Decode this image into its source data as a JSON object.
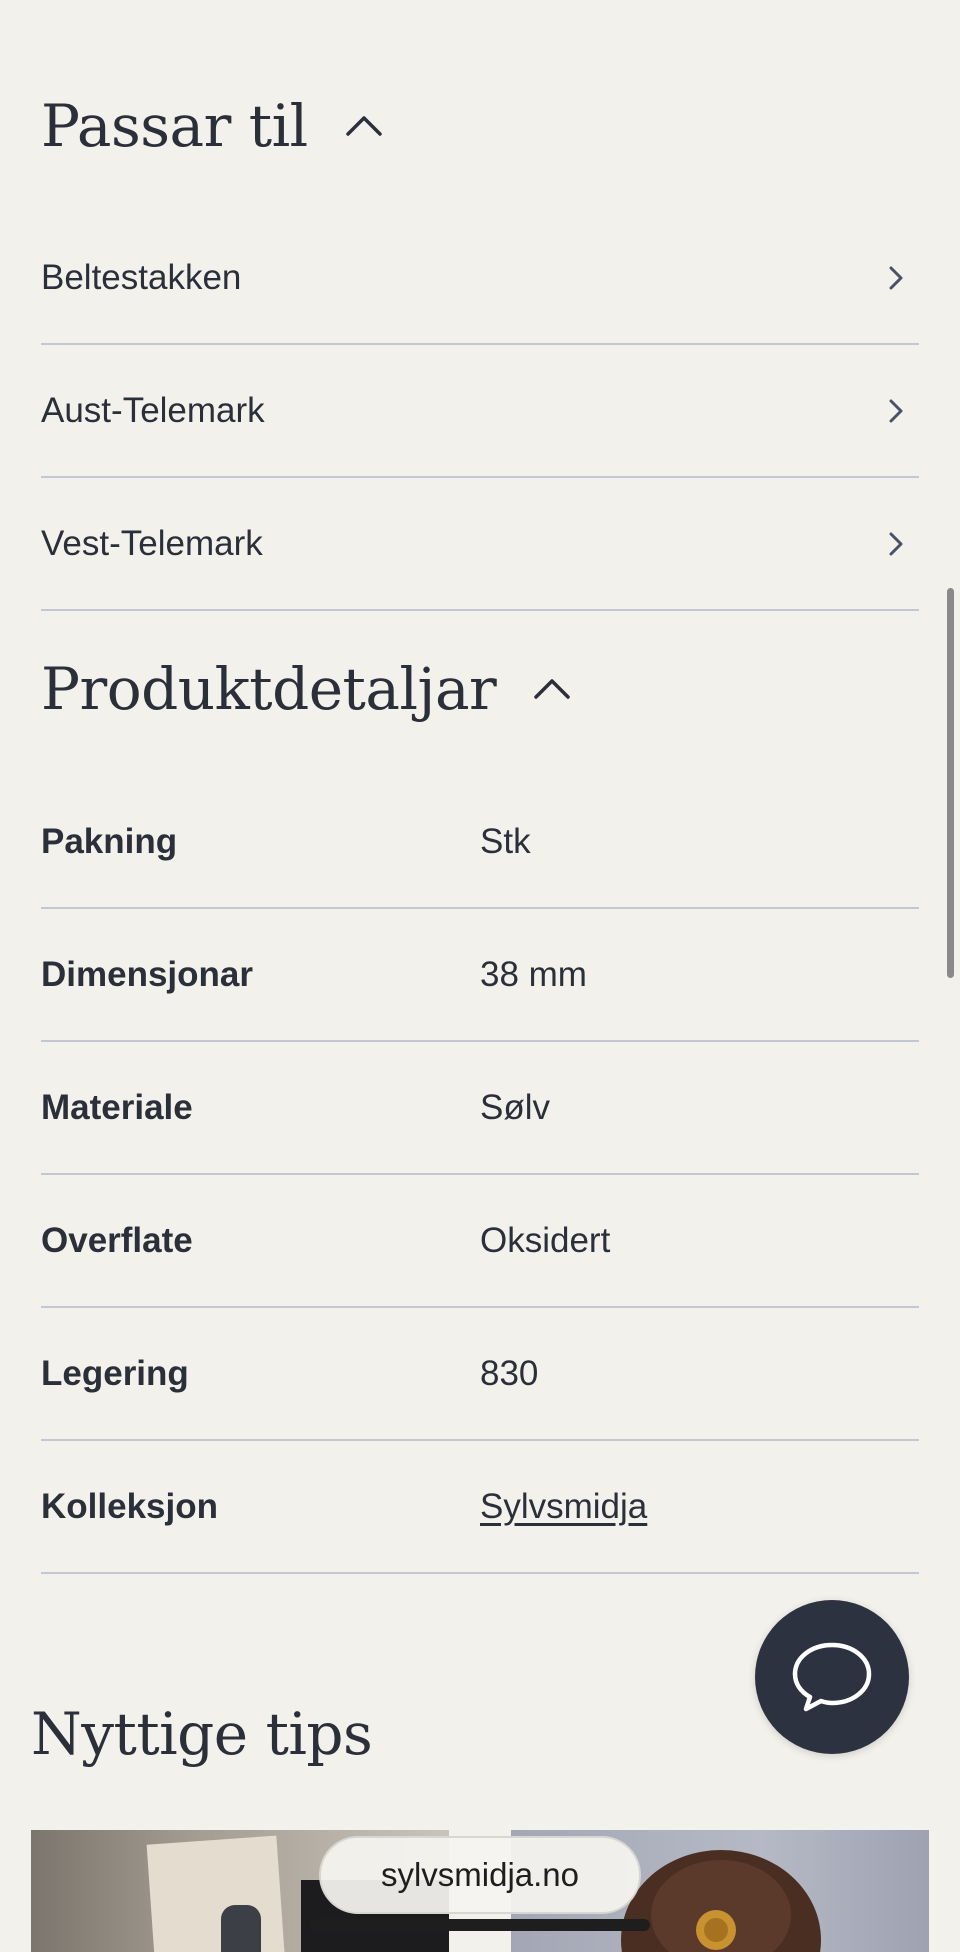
{
  "fits_section": {
    "title": "Passar til",
    "items": [
      {
        "label": "Beltestakken"
      },
      {
        "label": "Aust-Telemark"
      },
      {
        "label": "Vest-Telemark"
      }
    ]
  },
  "details_section": {
    "title": "Produktdetaljar",
    "rows": [
      {
        "key": "Pakning",
        "value": "Stk"
      },
      {
        "key": "Dimensjonar",
        "value": "38 mm"
      },
      {
        "key": "Materiale",
        "value": "Sølv"
      },
      {
        "key": "Overflate",
        "value": "Oksidert"
      },
      {
        "key": "Legering",
        "value": "830"
      },
      {
        "key": "Kolleksjon",
        "value": "Sylvsmidja"
      }
    ]
  },
  "tips_section": {
    "title": "Nyttige tips"
  },
  "browser": {
    "url": "sylvsmidja.no"
  },
  "icons": {
    "collapse": "chevron-up-icon",
    "row_arrow": "chevron-right-icon",
    "chat": "chat-bubble-icon"
  },
  "colors": {
    "background": "#f2f1eb",
    "text": "#2b2f3a",
    "divider": "#c3c6d3",
    "chat_button": "#2d3240"
  }
}
